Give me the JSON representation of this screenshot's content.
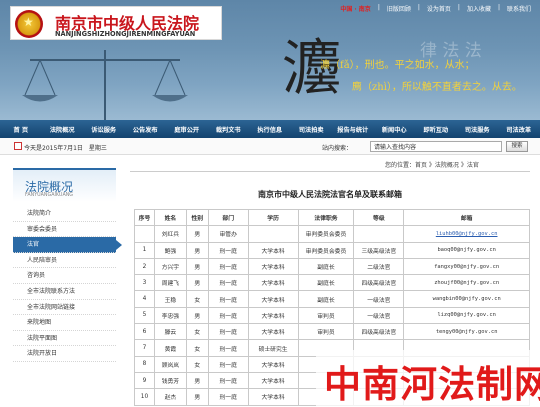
{
  "header": {
    "site_title": "南京市中级人民法院",
    "site_subtitle": "NANJINGSHIZHONGJIRENMINGFAYUAN",
    "top_links": [
      "中国 · 南京",
      "旧版回顾",
      "设为首页",
      "加入收藏",
      "联系我们"
    ],
    "calligraphy": "灋",
    "motto_line1": "灋（fǎ），刑也。平之如水，从水；",
    "motto_line2": "廌（zhì），所以触不直者去之。从去。",
    "faded_text": "律 法 法"
  },
  "nav": {
    "items": [
      "首 页",
      "法院概况",
      "诉讼服务",
      "公告发布",
      "庭审公开",
      "裁判文书",
      "执行信息",
      "司法拍卖",
      "报告与统计",
      "新闻中心",
      "即听互动",
      "司法服务",
      "司法改革"
    ]
  },
  "infobar": {
    "date": "今天是2015年7月1日　星期三",
    "search_label": "站内搜索：",
    "search_placeholder": "请输入查找内容",
    "search_button": "搜索"
  },
  "sidebar": {
    "title": "法院概况",
    "pinyin": "FANYUANGAIKUANG",
    "items": [
      "法院简介",
      "审委会委员",
      "法官",
      "人民陪审员",
      "咨询员",
      "全市法院联系方法",
      "全市法院网站链接",
      "来院地图",
      "法院平面图",
      "法院开放日"
    ],
    "active_index": 2
  },
  "breadcrumb": "您的位置：首页 》法院概况 》法官",
  "content": {
    "title": "南京市中级人民法院法官名单及联系邮箱",
    "columns": [
      "序号",
      "姓名",
      "性别",
      "部门",
      "学历",
      "法律职务",
      "等级",
      "邮箱"
    ],
    "rows": [
      [
        "",
        "刘红兵",
        "男",
        "审管办",
        "",
        "审判委员会委员",
        "",
        "liuhb00@njfy.gov.cn"
      ],
      [
        "1",
        "鲍强",
        "男",
        "刑一庭",
        "大学本科",
        "审判委员会委员",
        "三级高级法官",
        "baoq00@njfy.gov.cn"
      ],
      [
        "2",
        "方兴宇",
        "男",
        "刑一庭",
        "大学本科",
        "副庭长",
        "二级法官",
        "fangxy00@njfy.gov.cn"
      ],
      [
        "3",
        "周建飞",
        "男",
        "刑一庭",
        "大学本科",
        "副庭长",
        "四级高级法官",
        "zhoujf00@njfy.gov.cn"
      ],
      [
        "4",
        "王稳",
        "女",
        "刑一庭",
        "大学本科",
        "副庭长",
        "一级法官",
        "wangbin00@njfy.gov.cn"
      ],
      [
        "5",
        "李忠强",
        "男",
        "刑一庭",
        "大学本科",
        "审判员",
        "一级法官",
        "lizq00@njfy.gov.cn"
      ],
      [
        "6",
        "滕云",
        "女",
        "刑一庭",
        "大学本科",
        "审判员",
        "四级高级法官",
        "tengy00@njfy.gov.cn"
      ],
      [
        "7",
        "黄霞",
        "女",
        "刑一庭",
        "硕士研究生",
        "",
        "",
        ""
      ],
      [
        "8",
        "顾岚岚",
        "女",
        "刑一庭",
        "大学本科",
        "",
        "",
        ""
      ],
      [
        "9",
        "钱勇芳",
        "男",
        "刑一庭",
        "大学本科",
        "",
        "",
        ""
      ],
      [
        "10",
        "赵杰",
        "男",
        "刑一庭",
        "大学本科",
        "",
        "",
        ""
      ]
    ]
  },
  "watermark": "中南河法制网"
}
